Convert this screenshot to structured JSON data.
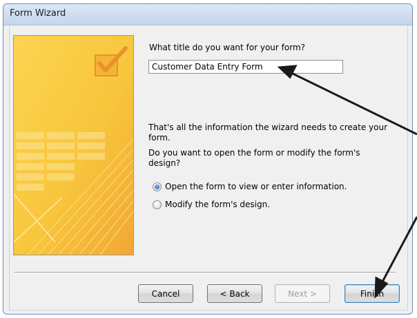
{
  "window": {
    "title": "Form Wizard"
  },
  "wizard": {
    "title_prompt": "What title do you want for your form?",
    "title_value": "Customer Data Entry Form",
    "info_text": "That's all the information the wizard needs to create your form.",
    "question": "Do you want to open the form or modify the form's design?",
    "options": [
      {
        "label": "Open the form to view or enter information.",
        "selected": true
      },
      {
        "label": "Modify the form's design.",
        "selected": false
      }
    ]
  },
  "buttons": {
    "cancel": "Cancel",
    "back": "< Back",
    "next": "Next >",
    "finish": "Finish"
  },
  "colors": {
    "art_yellow": "#f7c23a",
    "art_orange": "#f3a93a",
    "annotation_arrow": "#1a1a1a"
  }
}
